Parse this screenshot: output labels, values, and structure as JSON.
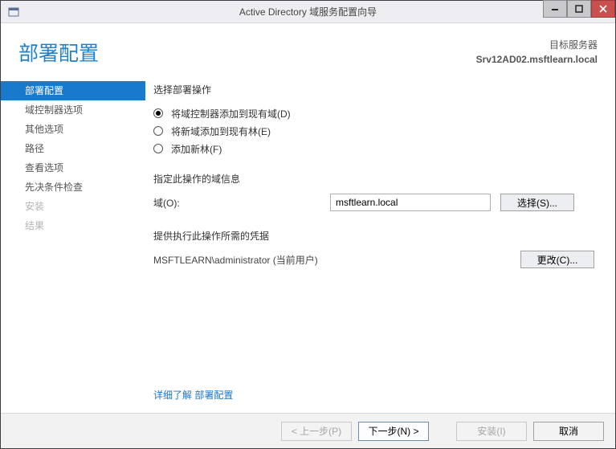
{
  "window": {
    "title": "Active Directory 域服务配置向导"
  },
  "header": {
    "page_title": "部署配置",
    "target_label": "目标服务器",
    "target_server": "Srv12AD02.msftlearn.local"
  },
  "sidebar": {
    "items": [
      {
        "label": "部署配置",
        "active": true,
        "disabled": false
      },
      {
        "label": "域控制器选项",
        "active": false,
        "disabled": false
      },
      {
        "label": "其他选项",
        "active": false,
        "disabled": false
      },
      {
        "label": "路径",
        "active": false,
        "disabled": false
      },
      {
        "label": "查看选项",
        "active": false,
        "disabled": false
      },
      {
        "label": "先决条件检查",
        "active": false,
        "disabled": false
      },
      {
        "label": "安装",
        "active": false,
        "disabled": true
      },
      {
        "label": "结果",
        "active": false,
        "disabled": true
      }
    ]
  },
  "main": {
    "select_op_label": "选择部署操作",
    "radios": [
      {
        "label": "将域控制器添加到现有域(D)",
        "selected": true
      },
      {
        "label": "将新域添加到现有林(E)",
        "selected": false
      },
      {
        "label": "添加新林(F)",
        "selected": false
      }
    ],
    "domain_section_label": "指定此操作的域信息",
    "domain_field_label": "域(O):",
    "domain_value": "msftlearn.local",
    "select_button": "选择(S)...",
    "creds_section_label": "提供执行此操作所需的凭据",
    "creds_user": "MSFTLEARN\\administrator (当前用户)",
    "change_button": "更改(C)...",
    "learn_more_prefix": "详细了解",
    "learn_more_link": "部署配置"
  },
  "footer": {
    "prev": "< 上一步(P)",
    "next": "下一步(N) >",
    "install": "安装(I)",
    "cancel": "取消"
  }
}
